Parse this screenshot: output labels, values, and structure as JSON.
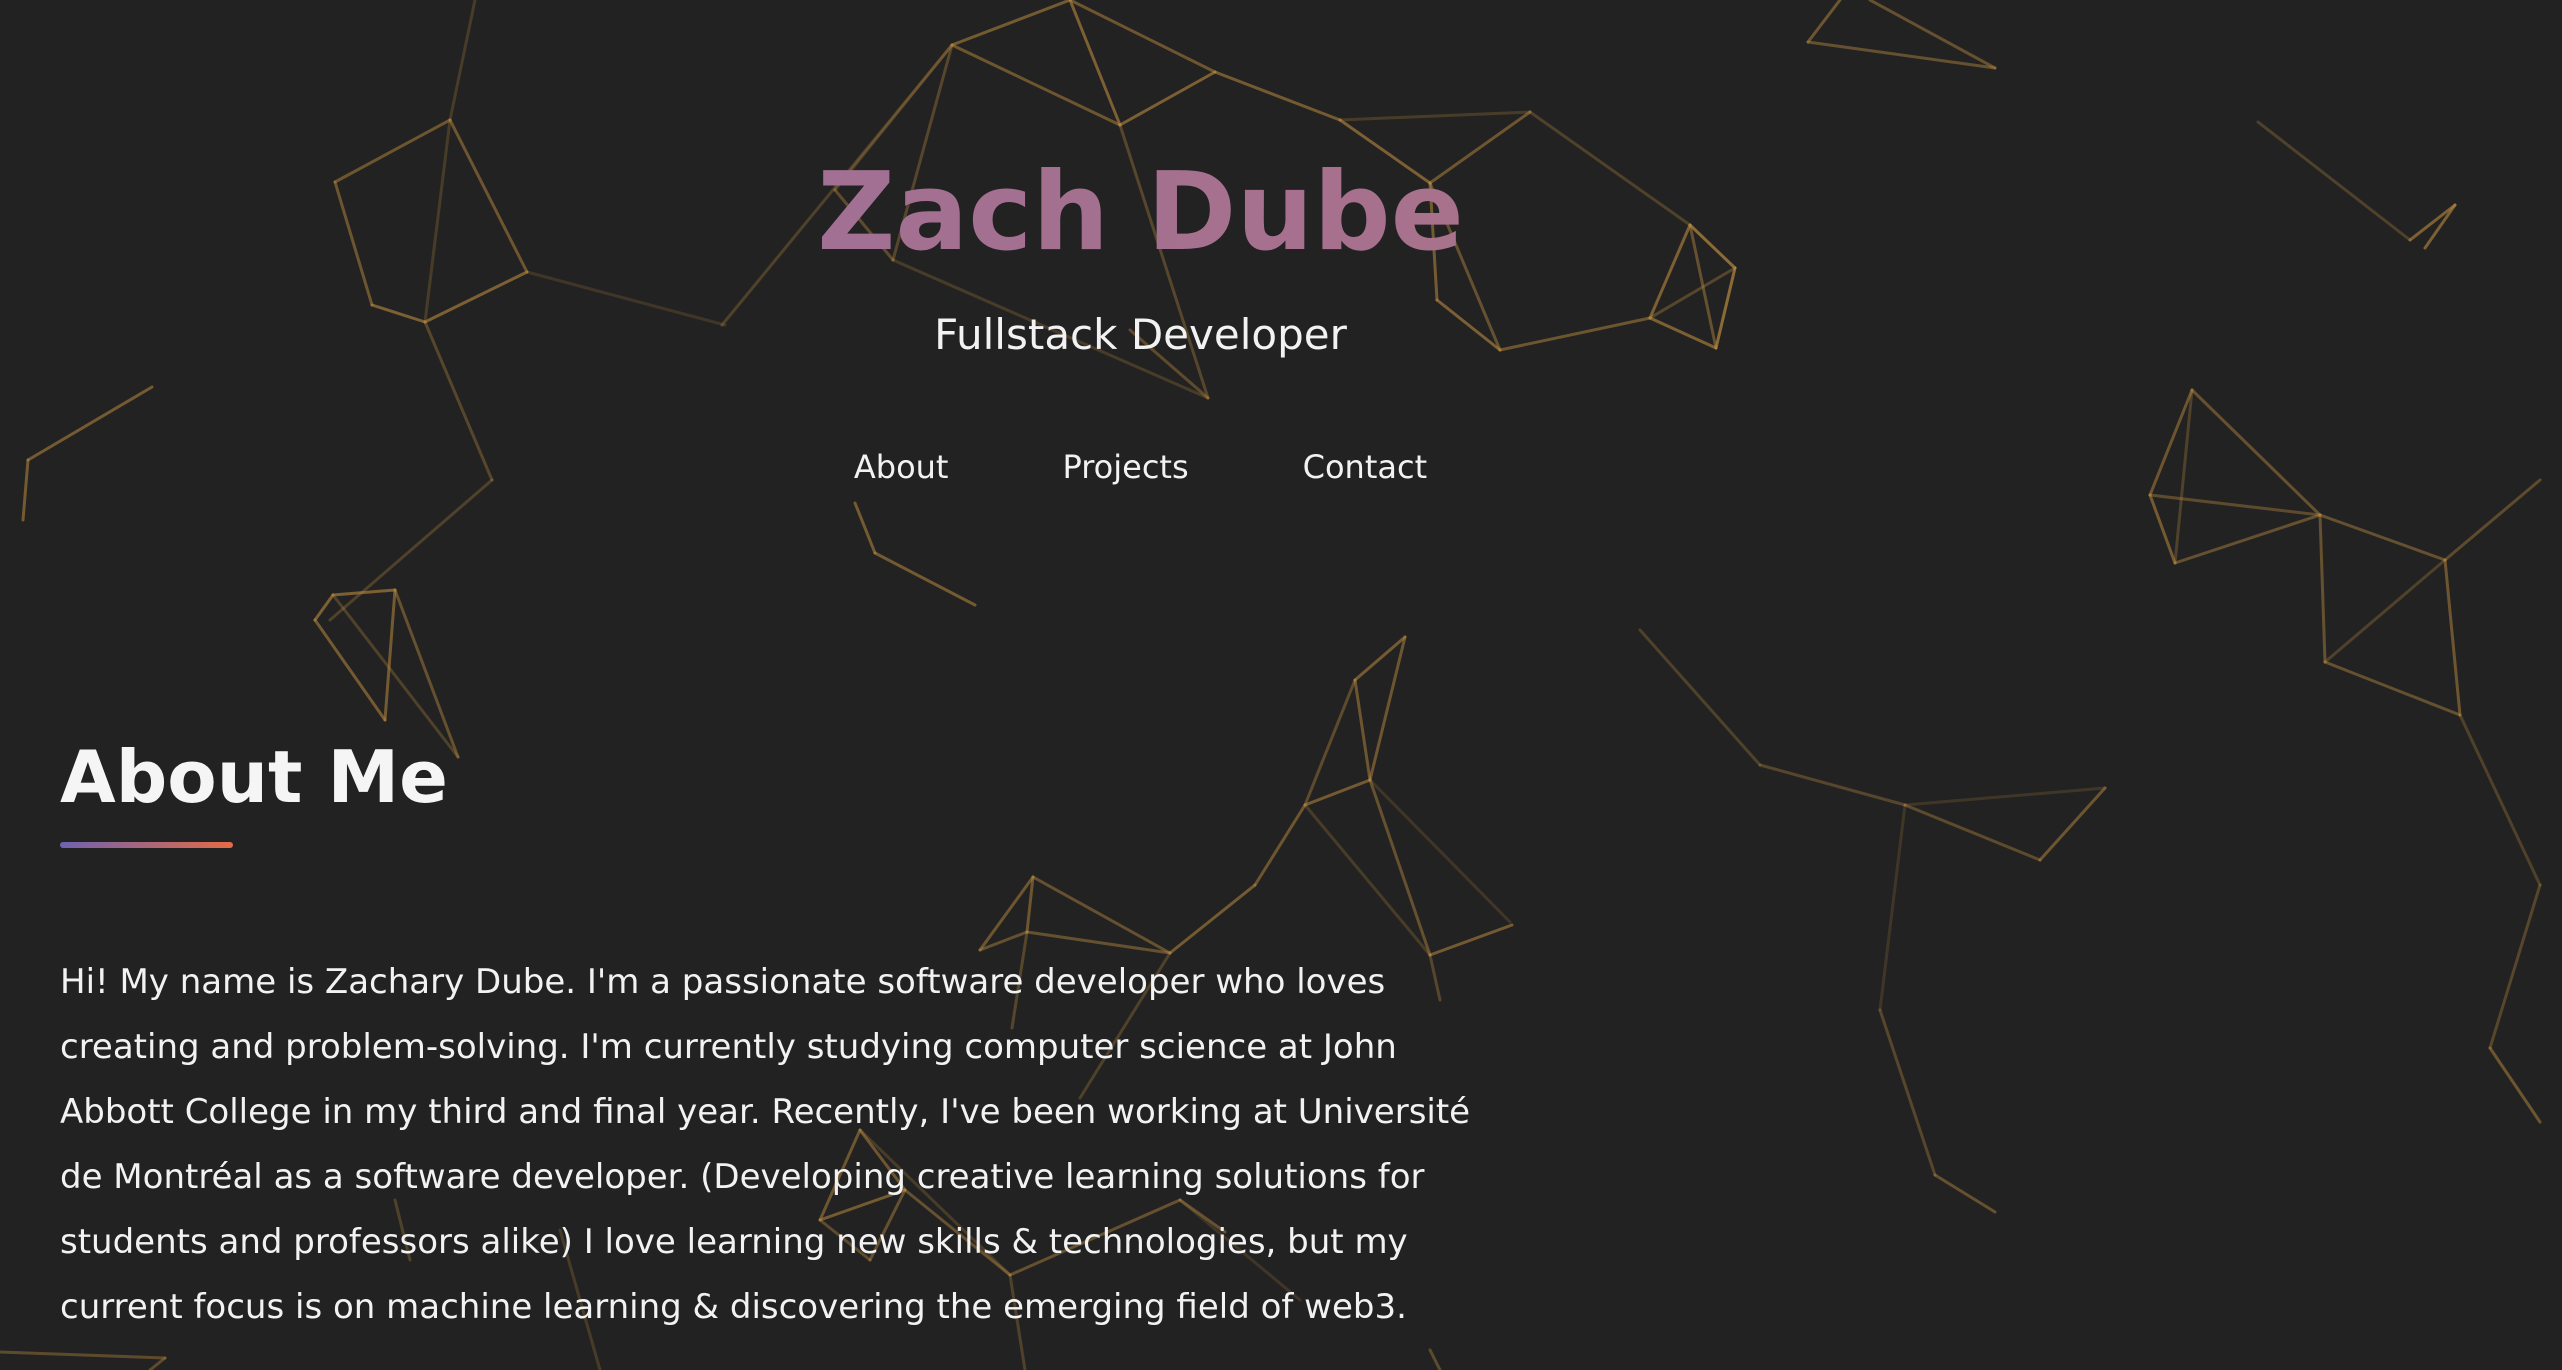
{
  "hero": {
    "name": "Zach Dube",
    "role": "Fullstack Developer"
  },
  "nav": {
    "items": [
      {
        "label": "About"
      },
      {
        "label": "Projects"
      },
      {
        "label": "Contact"
      }
    ]
  },
  "about": {
    "title": "About Me",
    "body": "Hi! My name is Zachary Dube. I'm a passionate software developer who loves creating and problem-solving. I'm currently studying computer science at John Abbott College in my third and final year. Recently, I've been working at Université de Montréal as a software developer. (Developing creative learning solutions for students and professors alike) I love learning new skills & technologies, but my current focus is on machine learning & discovering the emerging field of web3."
  },
  "colors": {
    "background": "#222222",
    "network_line": "#b8893f",
    "name_gradient_start": "#9a6f9c",
    "name_gradient_end": "#b07283",
    "underline_gradient_start": "#6e62b0",
    "underline_gradient_end": "#e56b46",
    "text": "#f2f2f2"
  }
}
